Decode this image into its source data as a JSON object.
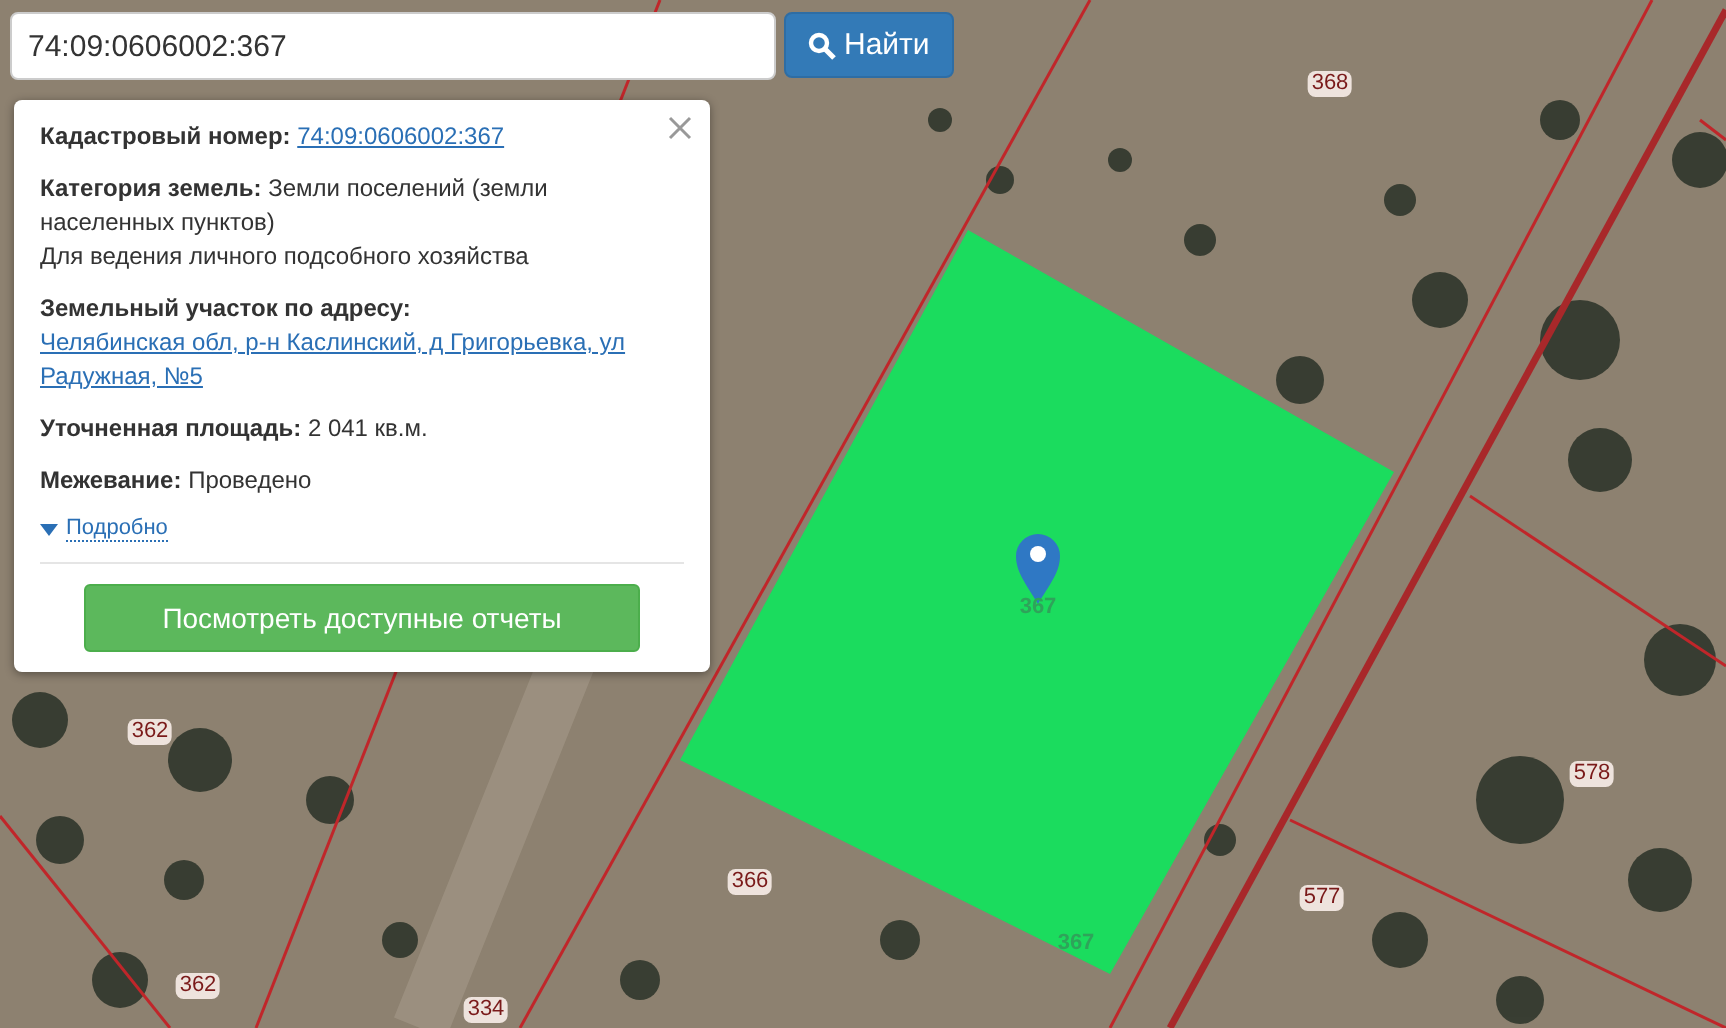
{
  "search": {
    "value": "74:09:0606002:367",
    "button": "Найти"
  },
  "info_card": {
    "fields": [
      {
        "kind": "link",
        "label": "Кадастровый номер:",
        "value": "74:09:0606002:367"
      },
      {
        "kind": "text",
        "label": "Категория земель:",
        "value": "Земли поселений (земли населенных пунктов)",
        "extra": "Для ведения личного подсобного хозяйства"
      },
      {
        "kind": "link",
        "label": "Земельный участок по адресу:",
        "value": "Челябинская обл, р-н Каслинский, д Григорьевка, ул Радужная, №5"
      },
      {
        "kind": "text",
        "label": "Уточненная площадь:",
        "value": "2 041 кв.м."
      },
      {
        "kind": "text",
        "label": "Межевание:",
        "value": "Проведено"
      }
    ],
    "details_link": "Подробно",
    "reports_button": "Посмотреть доступные отчеты"
  },
  "map": {
    "plot_labels": [
      {
        "text": "368",
        "selected": false
      },
      {
        "text": "362",
        "selected": false
      },
      {
        "text": "362",
        "selected": false
      },
      {
        "text": "334",
        "selected": false
      },
      {
        "text": "366",
        "selected": false
      },
      {
        "text": "577",
        "selected": false
      },
      {
        "text": "578",
        "selected": false
      },
      {
        "text": "367",
        "selected": true
      },
      {
        "text": "367",
        "selected": true
      }
    ]
  }
}
